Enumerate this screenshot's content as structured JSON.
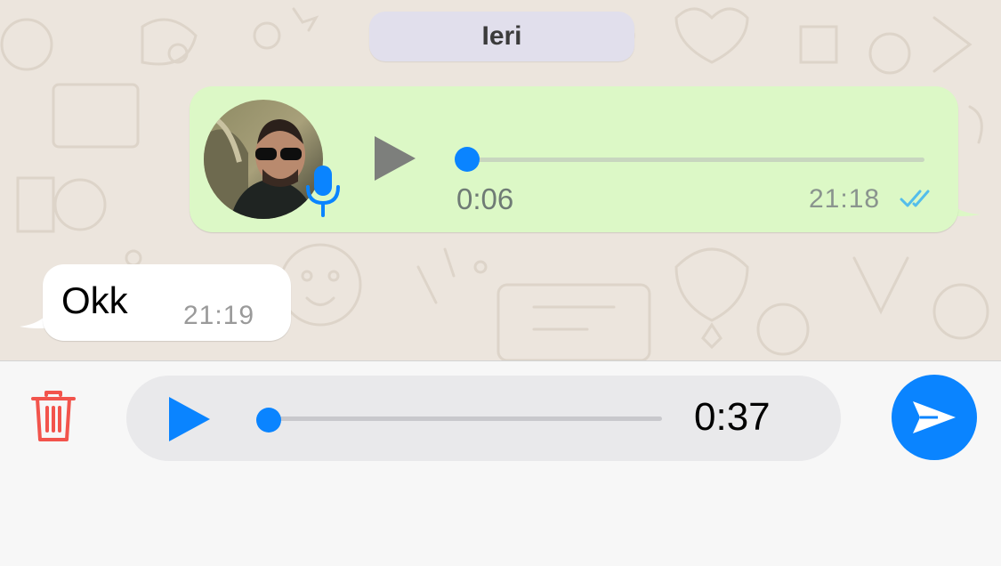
{
  "chat": {
    "date_separator": "Ieri",
    "outgoing_voice": {
      "duration": "0:06",
      "time": "21:18",
      "progress": 0,
      "read_status": "read",
      "icons": [
        "play-icon",
        "mic-icon",
        "double-check-icon"
      ]
    },
    "incoming_text": {
      "text": "Okk",
      "time": "21:19"
    }
  },
  "recorder": {
    "duration": "0:37",
    "progress": 0,
    "icons": [
      "trash-icon",
      "play-icon",
      "send-icon"
    ]
  },
  "colors": {
    "accent": "#0a84ff",
    "outgoing_bubble": "#dcf8c6",
    "incoming_bubble": "#ffffff",
    "chat_background": "#ece5dd",
    "trash": "#f2544c",
    "read_ticks": "#53bdeb"
  }
}
